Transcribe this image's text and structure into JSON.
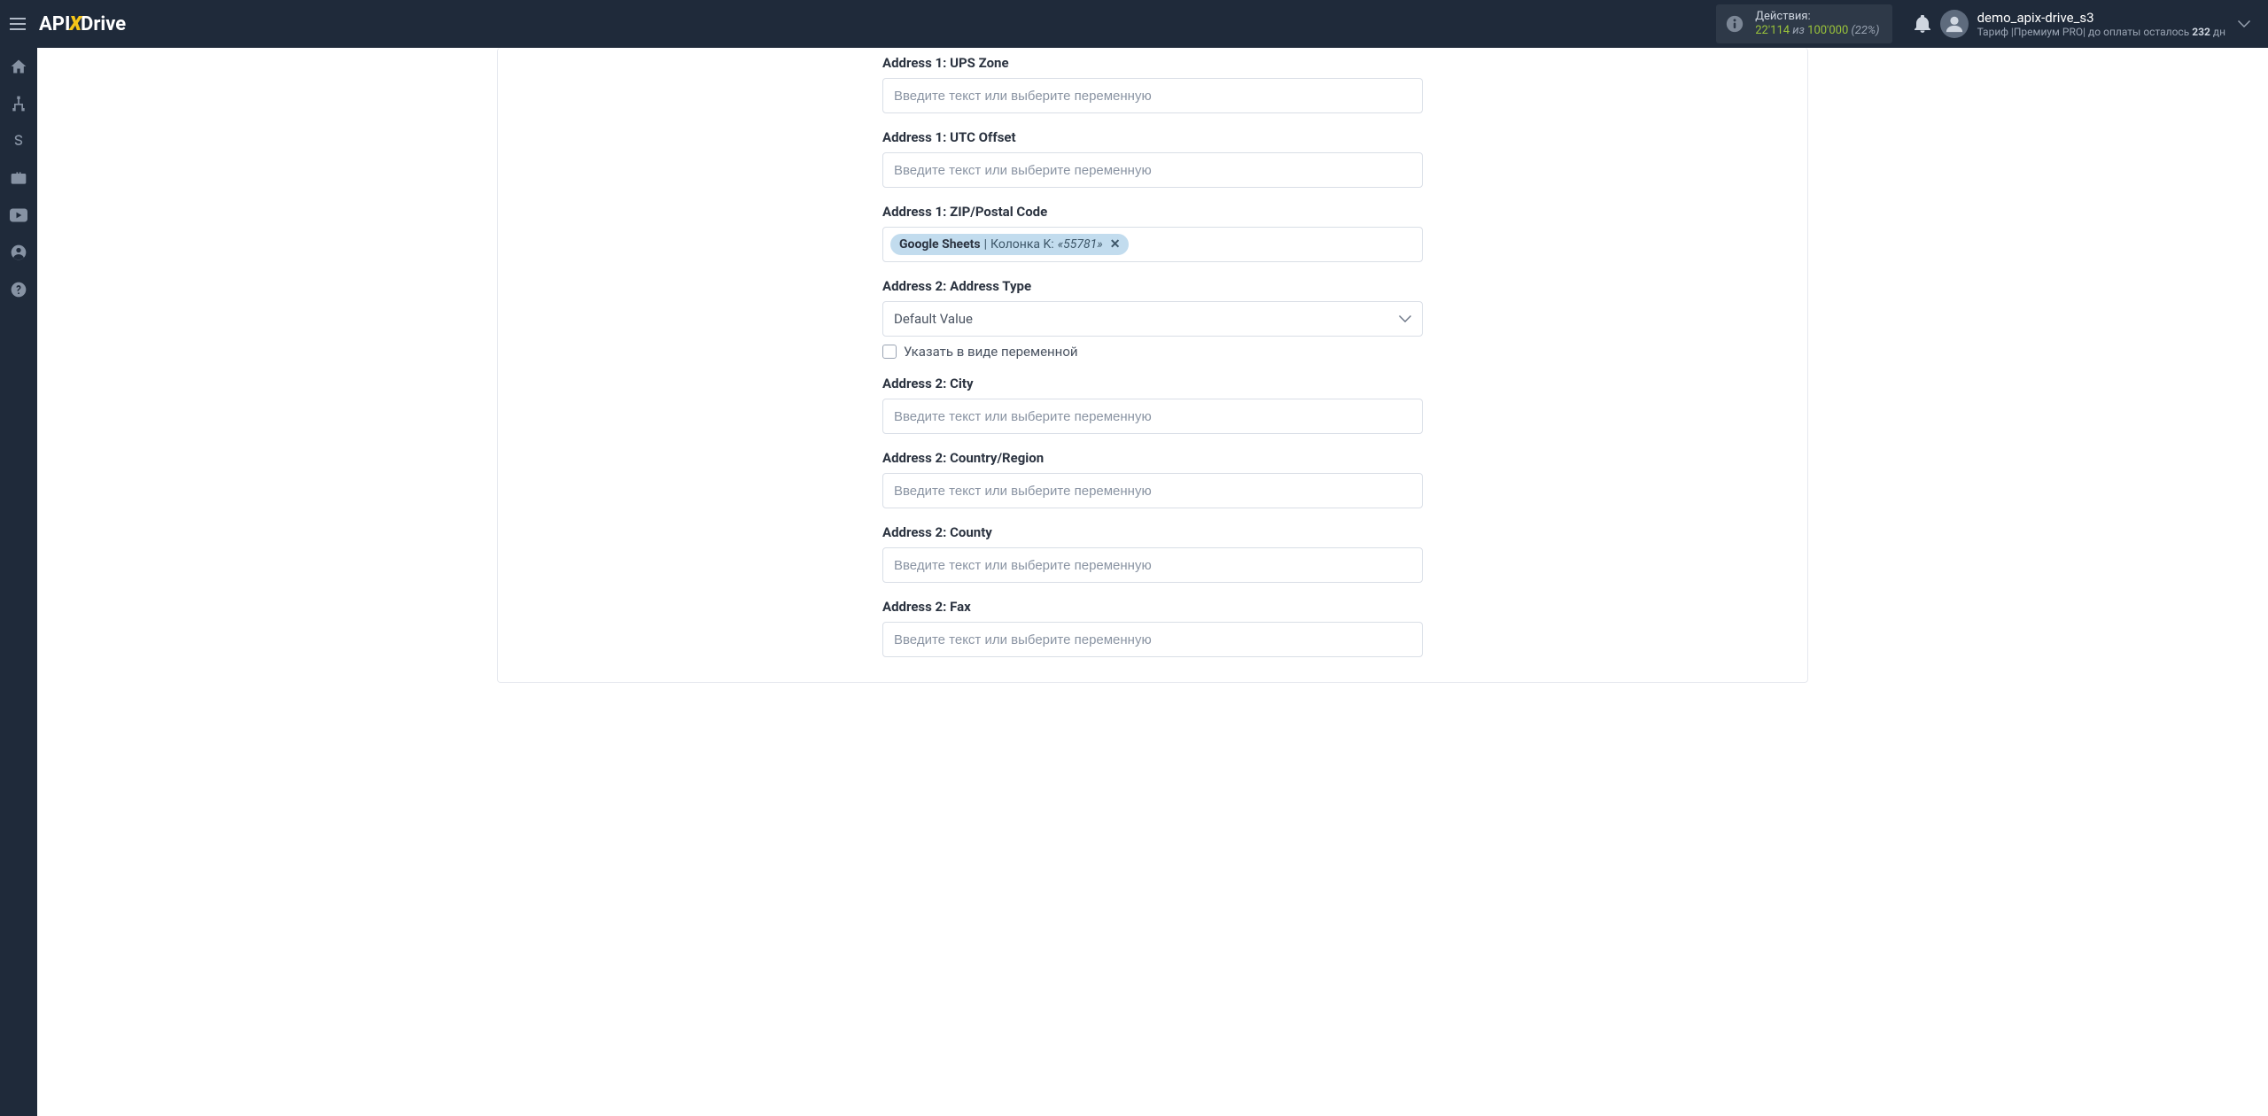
{
  "header": {
    "brand_a": "API",
    "brand_b": "X",
    "brand_c": "Drive",
    "actions_label": "Действия:",
    "actions_value": "22'114",
    "actions_of": " из ",
    "actions_max": "100'000",
    "actions_pct": " (22%)",
    "user_name": "demo_apix-drive_s3",
    "tariff_prefix": "Тариф |",
    "tariff_name": "Премиум PRO",
    "tariff_sep": "| до оплаты осталось ",
    "tariff_days": "232",
    "tariff_unit": " дн"
  },
  "placeholder": "Введите текст или выберите переменную",
  "fields": {
    "ups": {
      "label": "Address 1: UPS Zone"
    },
    "utc": {
      "label": "Address 1: UTC Offset"
    },
    "zip": {
      "label": "Address 1: ZIP/Postal Code",
      "chip_src": "Google Sheets",
      "chip_sep": " | ",
      "chip_col": "Колонка K: ",
      "chip_val": "«55781»"
    },
    "addr2type": {
      "label": "Address 2: Address Type",
      "select_value": "Default Value",
      "checkbox_label": "Указать в виде переменной"
    },
    "city": {
      "label": "Address 2: City"
    },
    "country": {
      "label": "Address 2: Country/Region"
    },
    "county": {
      "label": "Address 2: County"
    },
    "fax": {
      "label": "Address 2: Fax"
    }
  }
}
